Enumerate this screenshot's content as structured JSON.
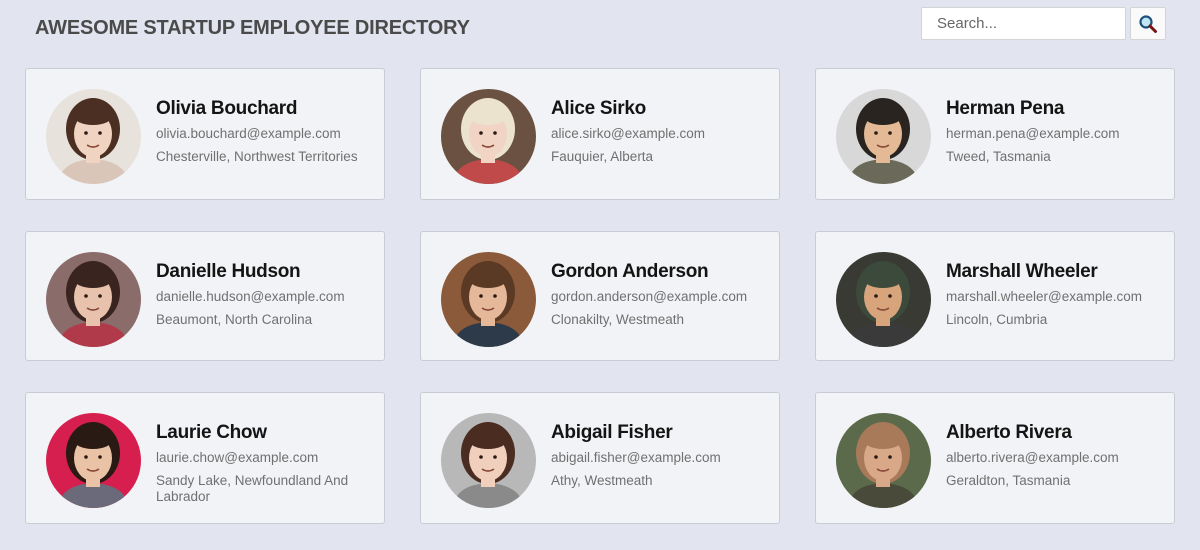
{
  "header": {
    "title": "AWESOME STARTUP EMPLOYEE DIRECTORY"
  },
  "search": {
    "placeholder": "Search...",
    "value": "",
    "icon": "search-icon"
  },
  "employees": [
    {
      "name": "Olivia Bouchard",
      "email": "olivia.bouchard@example.com",
      "location": "Chesterville, Northwest Territories",
      "avatar": {
        "bg": "#e8e2dc",
        "skin": "#f0d3c0",
        "hair": "#4a2f22",
        "shirt": "#d9c6b8"
      }
    },
    {
      "name": "Alice Sirko",
      "email": "alice.sirko@example.com",
      "location": "Fauquier, Alberta",
      "avatar": {
        "bg": "#6b5142",
        "skin": "#f1d4c4",
        "hair": "#ece3cf",
        "shirt": "#c04a4a"
      }
    },
    {
      "name": "Herman Pena",
      "email": "herman.pena@example.com",
      "location": "Tweed, Tasmania",
      "avatar": {
        "bg": "#d8d8d8",
        "skin": "#e3b996",
        "hair": "#2a2420",
        "shirt": "#6b6a5a"
      }
    },
    {
      "name": "Danielle Hudson",
      "email": "danielle.hudson@example.com",
      "location": "Beaumont, North Carolina",
      "avatar": {
        "bg": "#8a6c6a",
        "skin": "#e8c2ac",
        "hair": "#3a2420",
        "shirt": "#b13a4a"
      }
    },
    {
      "name": "Gordon Anderson",
      "email": "gordon.anderson@example.com",
      "location": "Clonakilty, Westmeath",
      "avatar": {
        "bg": "#8b5a3a",
        "skin": "#e6b89a",
        "hair": "#5a3a24",
        "shirt": "#2c3a4a"
      }
    },
    {
      "name": "Marshall Wheeler",
      "email": "marshall.wheeler@example.com",
      "location": "Lincoln, Cumbria",
      "avatar": {
        "bg": "#3a3a34",
        "skin": "#d8a47c",
        "hair": "#3b4a3a",
        "shirt": "#3a3a3a"
      }
    },
    {
      "name": "Laurie Chow",
      "email": "laurie.chow@example.com",
      "location": "Sandy Lake, Newfoundland And Labrador",
      "avatar": {
        "bg": "#d61f4e",
        "skin": "#eac2a6",
        "hair": "#2a1a14",
        "shirt": "#6a6a7a"
      }
    },
    {
      "name": "Abigail Fisher",
      "email": "abigail.fisher@example.com",
      "location": "Athy, Westmeath",
      "avatar": {
        "bg": "#b8b8b8",
        "skin": "#f0d0bc",
        "hair": "#4a2c20",
        "shirt": "#8a8a8a"
      }
    },
    {
      "name": "Alberto Rivera",
      "email": "alberto.rivera@example.com",
      "location": "Geraldton, Tasmania",
      "avatar": {
        "bg": "#5a6a4a",
        "skin": "#d8a888",
        "hair": "#a87a5a",
        "shirt": "#4a4a3a"
      }
    }
  ]
}
